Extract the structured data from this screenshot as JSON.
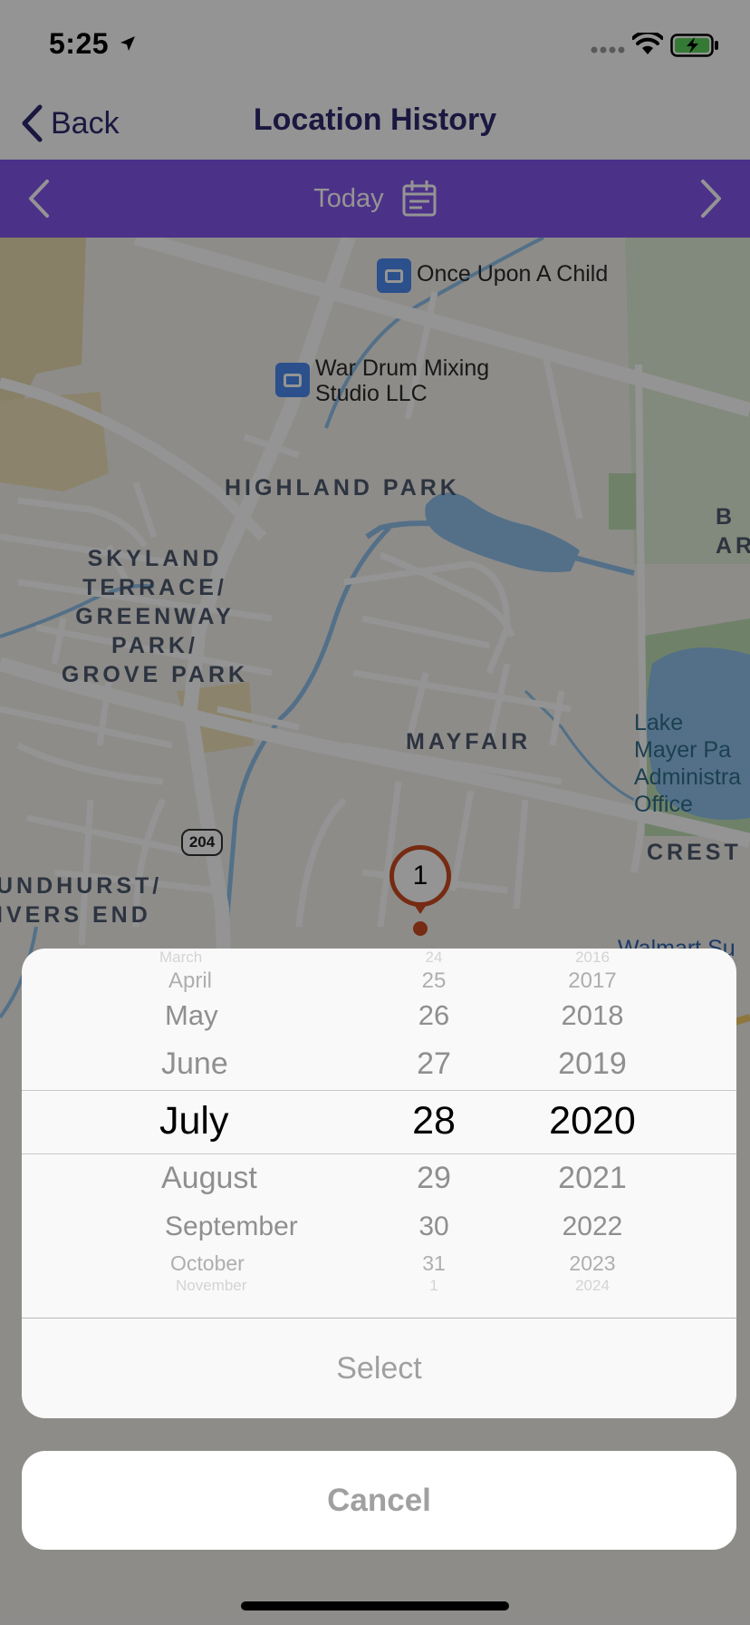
{
  "status_bar": {
    "time": "5:25"
  },
  "nav": {
    "back_label": "Back",
    "title": "Location History"
  },
  "date_bar": {
    "label": "Today"
  },
  "map": {
    "pin_label": "1",
    "neighborhoods": {
      "highland_park": "HIGHLAND PARK",
      "skyland": "SKYLAND\nTERRACE/\nGREENWAY\nPARK/\nGROVE PARK",
      "mayfair": "MAYFAIR",
      "lyndhurst": "UNDHURST/\nIVERS END",
      "crest": "CREST",
      "bar": "B\nAR"
    },
    "places": {
      "once_upon": "Once Upon A Child",
      "war_drum": "War Drum Mixing\nStudio LLC",
      "walmart": "Walmart Su",
      "lake": "Lake\nMayer Pa\nAdministra\nOffice"
    },
    "route_number": "204"
  },
  "picker": {
    "months": [
      "March",
      "April",
      "May",
      "June",
      "July",
      "August",
      "September",
      "October",
      "November"
    ],
    "days": [
      "24",
      "25",
      "26",
      "27",
      "28",
      "29",
      "30",
      "31",
      "1"
    ],
    "years": [
      "2016",
      "2017",
      "2018",
      "2019",
      "2020",
      "2021",
      "2022",
      "2023",
      "2024"
    ],
    "selected": {
      "month": "July",
      "day": "28",
      "year": "2020"
    },
    "select_label": "Select",
    "cancel_label": "Cancel"
  },
  "colors": {
    "nav_text": "#2e2a6e",
    "date_bar": "#8455ea",
    "pin": "#cc4a22",
    "water": "#8fc1ea",
    "park": "#bfe0b5"
  }
}
